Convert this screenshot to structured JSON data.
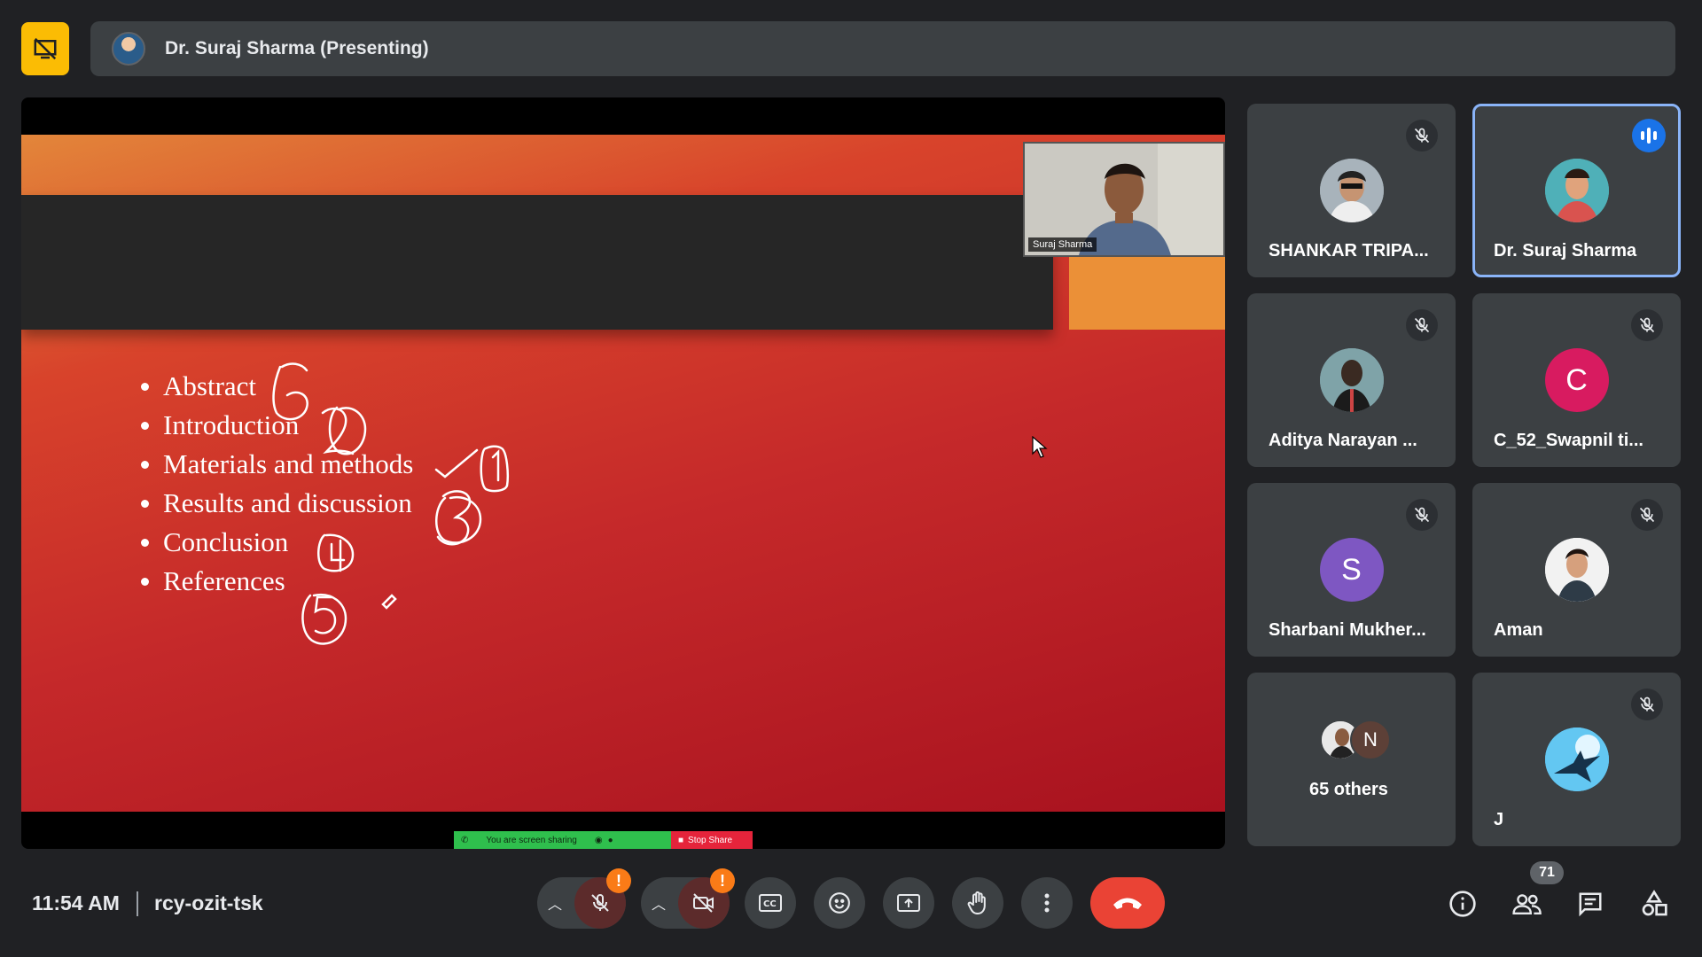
{
  "header": {
    "presenter_label": "Dr. Suraj Sharma (Presenting)"
  },
  "slide": {
    "items": [
      "Abstract",
      "Introduction",
      "Materials and methods",
      "Results and discussion",
      "Conclusion",
      "References"
    ],
    "self_view_name": "Suraj Sharma",
    "share_status": "You are screen sharing",
    "stop_share_label": "Stop Share"
  },
  "participants": [
    {
      "name": "SHANKAR TRIPA...",
      "muted": true
    },
    {
      "name": "Dr. Suraj Sharma",
      "speaking": true
    },
    {
      "name": "Aditya Narayan ...",
      "muted": true
    },
    {
      "name": "C_52_Swapnil ti...",
      "initial": "C",
      "color": "#d81b60",
      "muted": true
    },
    {
      "name": "Sharbani Mukher...",
      "initial": "S",
      "color": "#7e57c2",
      "muted": true
    },
    {
      "name": "Aman",
      "muted": true
    },
    {
      "name": "65 others",
      "initial": "N"
    },
    {
      "name": "J",
      "muted": true
    }
  ],
  "footer": {
    "time": "11:54 AM",
    "meeting_code": "rcy-ozit-tsk",
    "mic_warning": "!",
    "cam_warning": "!",
    "people_count": "71"
  },
  "colors": {
    "accent": "#8ab4f8",
    "end_call": "#ea4335",
    "warning": "#fa7b17",
    "pin": "#fbbc04"
  }
}
